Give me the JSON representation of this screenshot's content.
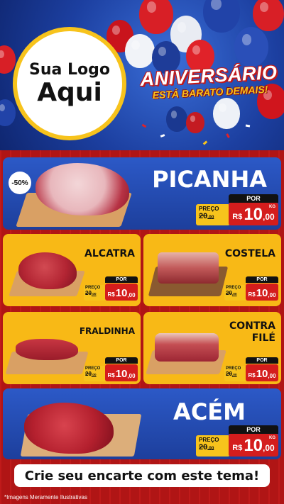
{
  "logo": {
    "line1": "Sua Logo",
    "line2": "Aqui"
  },
  "campaign": {
    "title": "ANIVERSÁRIO",
    "subtitle": "ESTÁ BARATO DEMAIS!"
  },
  "price_labels": {
    "por": "POR",
    "preco": "PREÇO",
    "currency": "R$",
    "unit": "KG"
  },
  "products": {
    "picanha": {
      "name": "PICANHA",
      "badge": "-50%",
      "old_int": "20",
      "old_cents": ",00",
      "new_int": "10",
      "new_cents": ",00"
    },
    "alcatra": {
      "name": "ALCATRA",
      "old_int": "20",
      "old_cents": ",00",
      "new_int": "10",
      "new_cents": ",00"
    },
    "costela": {
      "name": "COSTELA",
      "old_int": "20",
      "old_cents": ",00",
      "new_int": "10",
      "new_cents": ",00"
    },
    "fraldinha": {
      "name": "FRALDINHA",
      "old_int": "20",
      "old_cents": ",00",
      "new_int": "10",
      "new_cents": ",00"
    },
    "contrafile": {
      "name_line1": "CONTRA",
      "name_line2": "FILÉ",
      "old_int": "20",
      "old_cents": ",00",
      "new_int": "10",
      "new_cents": ",00"
    },
    "acem": {
      "name": "ACÉM",
      "old_int": "20",
      "old_cents": ",00",
      "new_int": "10",
      "new_cents": ",00"
    }
  },
  "footer": {
    "cta": "Crie seu encarte com este tema!",
    "disclaimer": "*Imagens Meramente Ilustrativas"
  },
  "colors": {
    "blue": "#2c59c7",
    "yellow": "#f8b916",
    "red": "#d41d1d",
    "background": "#b71c1c"
  }
}
